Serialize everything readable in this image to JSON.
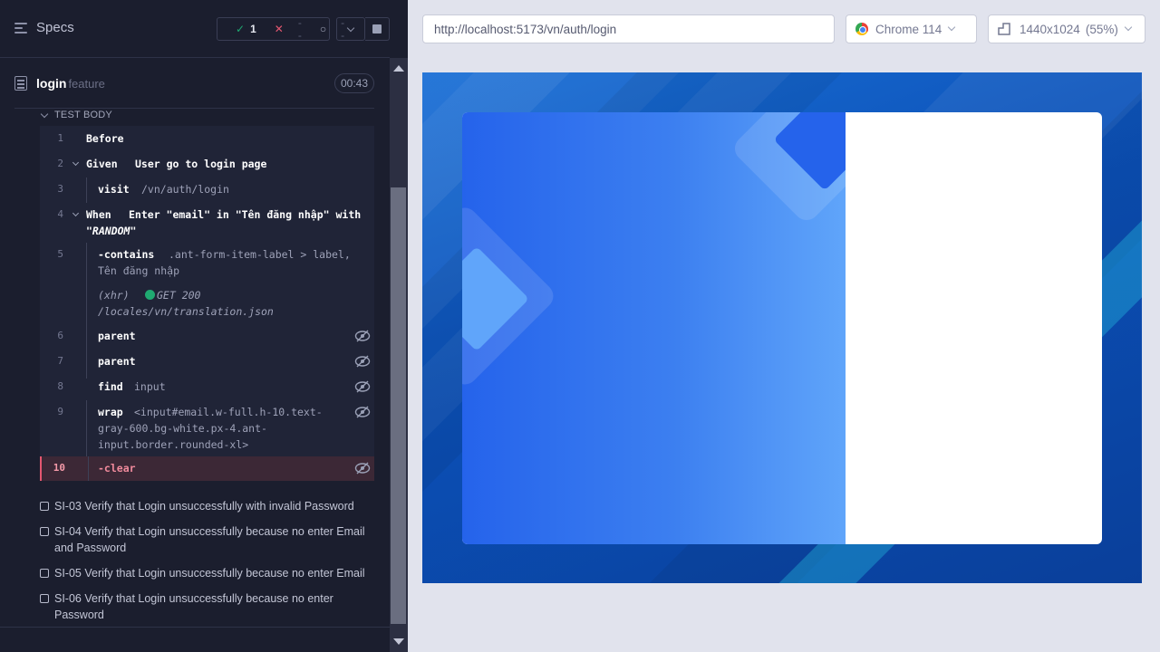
{
  "runner": {
    "specs_label": "Specs",
    "stats": {
      "passed": "1",
      "failed": "--",
      "pending": "--"
    },
    "spec": {
      "name": "login",
      "ext": "feature",
      "duration": "00:43"
    },
    "test_body_label": "TEST BODY",
    "commands": [
      {
        "num": "1",
        "keyword": "Before",
        "text": ""
      },
      {
        "num": "2",
        "keyword": "Given",
        "text": "User go to login page"
      },
      {
        "num": "3",
        "keyword": "visit",
        "text": "/vn/auth/login"
      },
      {
        "num": "4",
        "keyword": "When",
        "text": "Enter \"email\" in \"Tên đăng nhập\" with",
        "text2": "\"RANDOM\""
      },
      {
        "num": "5",
        "keyword": "-contains",
        "text": ".ant-form-item-label > label,",
        "text2": "Tên đăng nhập"
      },
      {
        "num": "",
        "keyword": "(xhr)",
        "text": "GET 200",
        "text2": "/locales/vn/translation.json"
      },
      {
        "num": "6",
        "keyword": "parent",
        "text": ""
      },
      {
        "num": "7",
        "keyword": "parent",
        "text": ""
      },
      {
        "num": "8",
        "keyword": "find",
        "text": "input"
      },
      {
        "num": "9",
        "keyword": "wrap",
        "text": "<input#email.w-full.h-10.text-",
        "text2": "gray-600.bg-white.px-4.ant-",
        "text3": "input.border.rounded-xl>"
      },
      {
        "num": "10",
        "keyword": "-clear",
        "text": ""
      }
    ],
    "tests": [
      {
        "label": "SI-03 Verify that Login unsuccessfully with invalid Password"
      },
      {
        "label": "SI-04 Verify that Login unsuccessfully because no enter Email and Password"
      },
      {
        "label": "SI-05 Verify that Login unsuccessfully because no enter Email"
      },
      {
        "label": "SI-06 Verify that Login unsuccessfully because no enter Password"
      }
    ]
  },
  "aut": {
    "url": "http://localhost:5173/vn/auth/login",
    "browser": "Chrome 114",
    "viewport": "1440x1024",
    "zoom": "(55%)"
  },
  "icons": [
    "specs-menu-icon",
    "check-icon",
    "x-icon",
    "pending-icon",
    "chevron-down-icon",
    "stop-icon",
    "file-icon",
    "eye-slash-icon",
    "chrome-icon",
    "viewport-icon"
  ],
  "colors": {
    "runner_bg": "#1b1e2e",
    "pass": "#1fa971",
    "fail": "#e45770",
    "aut_blue": "#0b4fb5"
  }
}
